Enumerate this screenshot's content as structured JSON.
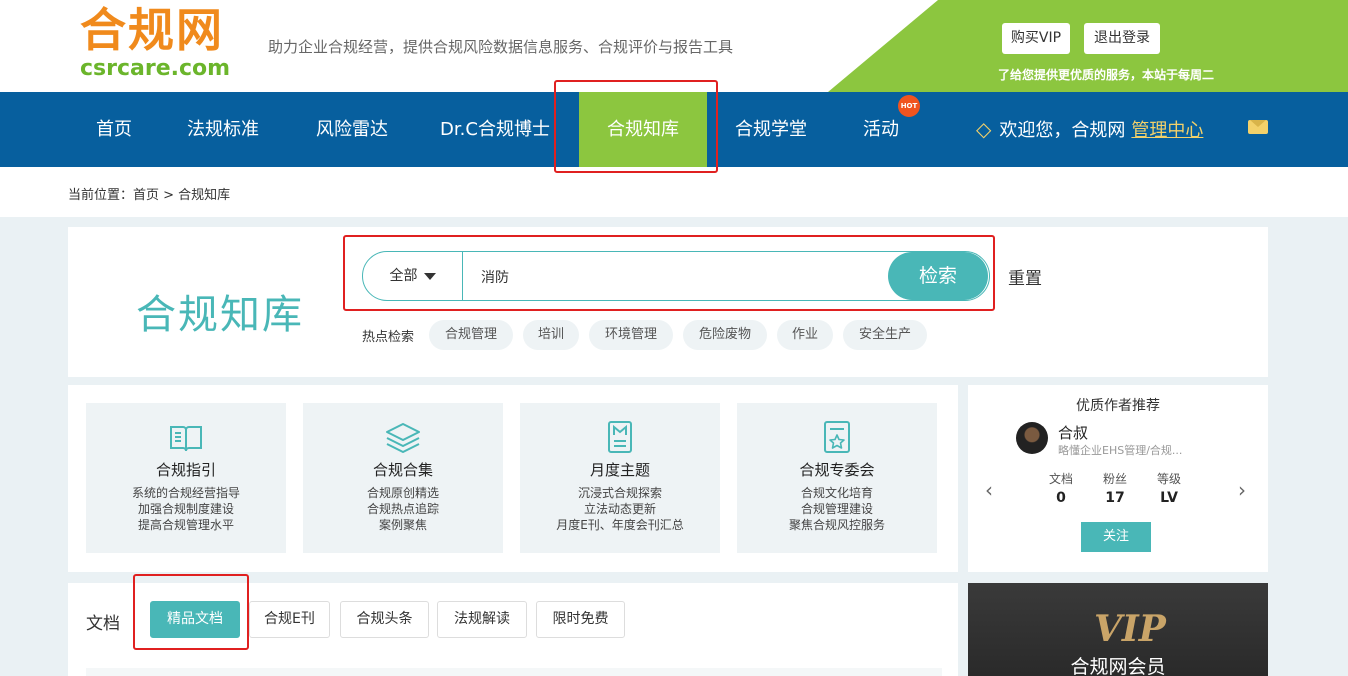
{
  "header": {
    "logo_cn": "合规网",
    "logo_en": "csrcare.com",
    "slogan": "助力企业合规经营，提供合规风险数据信息服务、合规评价与报告工具",
    "buy_vip": "购买VIP",
    "logout": "退出登录",
    "notice": "了给您提供更优质的服务，本站于每周二"
  },
  "nav": {
    "items": [
      "首页",
      "法规标准",
      "风险雷达",
      "Dr.C合规博士",
      "合规知库",
      "合规学堂",
      "活动"
    ],
    "active": "合规知库",
    "hot_badge": "HOT",
    "welcome": "欢迎您，合规网",
    "management": "管理中心"
  },
  "breadcrumb": "当前位置：首页 > 合规知库",
  "search": {
    "page_title": "合规知库",
    "category": "全部",
    "query": "消防",
    "button": "检索",
    "reset": "重置",
    "hot_label": "热点检索",
    "hot_tags": [
      "合规管理",
      "培训",
      "环境管理",
      "危险废物",
      "作业",
      "安全生产"
    ]
  },
  "categories": [
    {
      "icon": "book-icon",
      "title": "合规指引",
      "desc": [
        "系统的合规经营指导",
        "加强合规制度建设",
        "提高合规管理水平"
      ]
    },
    {
      "icon": "layers-icon",
      "title": "合规合集",
      "desc": [
        "合规原创精选",
        "合规热点追踪",
        "案例聚焦"
      ]
    },
    {
      "icon": "document-m-icon",
      "title": "月度主题",
      "desc": [
        "沉浸式合规探索",
        "立法动态更新",
        "月度E刊、年度会刊汇总"
      ]
    },
    {
      "icon": "certificate-icon",
      "title": "合规专委会",
      "desc": [
        "合规文化培育",
        "合规管理建设",
        "聚焦合规风控服务"
      ]
    }
  ],
  "author": {
    "heading": "优质作者推荐",
    "name": "合叔",
    "bio": "略懂企业EHS管理/合规...",
    "stats": [
      {
        "label": "文档",
        "value": "0"
      },
      {
        "label": "粉丝",
        "value": "17"
      },
      {
        "label": "等级",
        "value": "LV"
      }
    ],
    "follow": "关注"
  },
  "docs": {
    "label": "文档",
    "tabs": [
      "精品文档",
      "合规E刊",
      "合规头条",
      "法规解读",
      "限时免费"
    ],
    "active": "精品文档"
  },
  "vip": {
    "logo": "VIP",
    "title": "合规网会员"
  },
  "colors": {
    "nav_blue": "#075f9e",
    "accent_green": "#8cc63f",
    "teal": "#49b7b7",
    "logo_orange": "#f08a1c"
  }
}
